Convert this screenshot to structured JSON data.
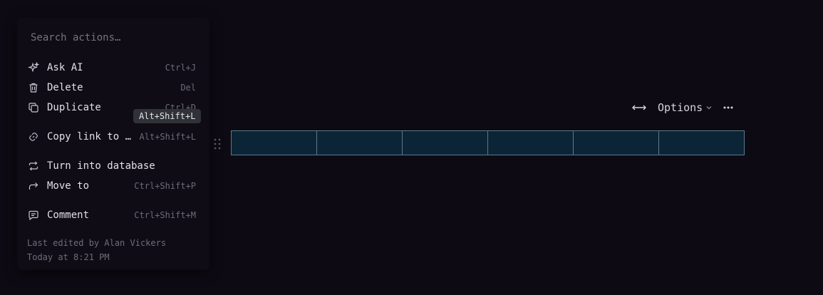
{
  "menu": {
    "search_placeholder": "Search actions…",
    "items": [
      {
        "label": "Ask AI",
        "shortcut": "Ctrl+J",
        "icon": "sparkle-icon"
      },
      {
        "label": "Delete",
        "shortcut": "Del",
        "icon": "trash-icon"
      },
      {
        "label": "Duplicate",
        "shortcut": "Ctrl+D",
        "icon": "duplicate-icon"
      },
      {
        "label": "Copy link to …",
        "shortcut": "Alt+Shift+L",
        "icon": "link-icon"
      },
      {
        "label": "Turn into database",
        "shortcut": "",
        "icon": "convert-icon"
      },
      {
        "label": "Move to",
        "shortcut": "Ctrl+Shift+P",
        "icon": "move-arrow-icon"
      },
      {
        "label": "Comment",
        "shortcut": "Ctrl+Shift+M",
        "icon": "comment-icon"
      }
    ],
    "footer": {
      "edited_by": "Last edited by Alan Vickers",
      "edited_at": "Today at 8:21 PM"
    }
  },
  "tooltip": {
    "text": "Alt+Shift+L"
  },
  "toolbar": {
    "width_icon": "horizontal-resize-icon",
    "options_label": "Options",
    "more_icon": "more-horizontal-icon"
  },
  "table": {
    "columns": 6,
    "cells": [
      "",
      "",
      "",
      "",
      "",
      ""
    ],
    "fill_color": "#0b2536",
    "border_color": "#5a7a8a"
  },
  "colors": {
    "background": "#0d0a13",
    "menu_background": "#0f0c16",
    "text": "#e2dfe8",
    "muted": "#6e6a78"
  }
}
